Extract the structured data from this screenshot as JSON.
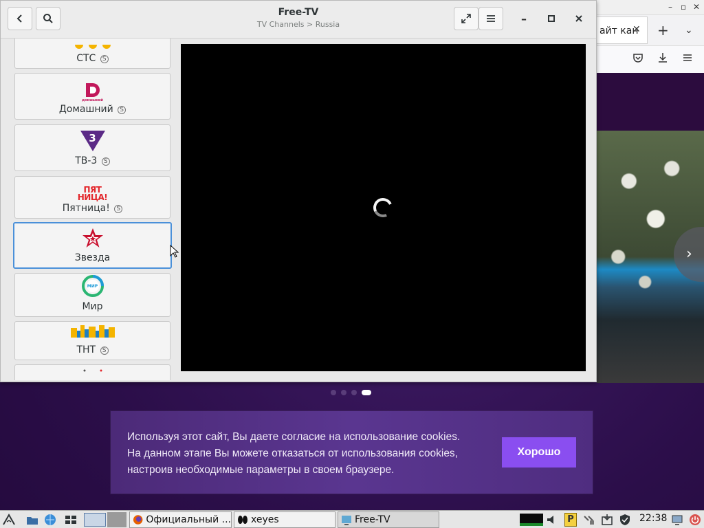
{
  "app": {
    "title": "Free-TV",
    "subtitle": "TV Channels > Russia",
    "channels": [
      {
        "name": "СТС",
        "sub": "S"
      },
      {
        "name": "Домашний",
        "sub": "S",
        "logo_text": "домашний"
      },
      {
        "name": "ТВ-3",
        "sub": "S",
        "logo_text": "3"
      },
      {
        "name": "Пятница!",
        "sub": "S",
        "logo_text": "ПЯТ НИЦА!"
      },
      {
        "name": "Звезда",
        "selected": true
      },
      {
        "name": "Мир",
        "logo_text": "МИР"
      },
      {
        "name": "ТНТ",
        "sub": "S"
      }
    ]
  },
  "browser": {
    "tab_title": "айт кан",
    "tab_close": "✕",
    "new_tab": "+",
    "tab_list": "⌄",
    "carousel_next": "›"
  },
  "cookie_banner": {
    "lines": [
      "Используя этот сайт, Вы даете согласие на использование cookies.",
      "На данном этапе Вы можете отказаться от использования cookies,",
      "настроив необходимые параметры в своем браузере."
    ],
    "button": "Хорошо"
  },
  "taskbar": {
    "tasks": [
      "Официальный ...",
      "xeyes",
      "Free-TV"
    ],
    "clock": "22:38"
  },
  "colors": {
    "selection": "#4a90d9",
    "cookie_button": "#8a4ef0",
    "page_bg": "#2b0e49"
  }
}
